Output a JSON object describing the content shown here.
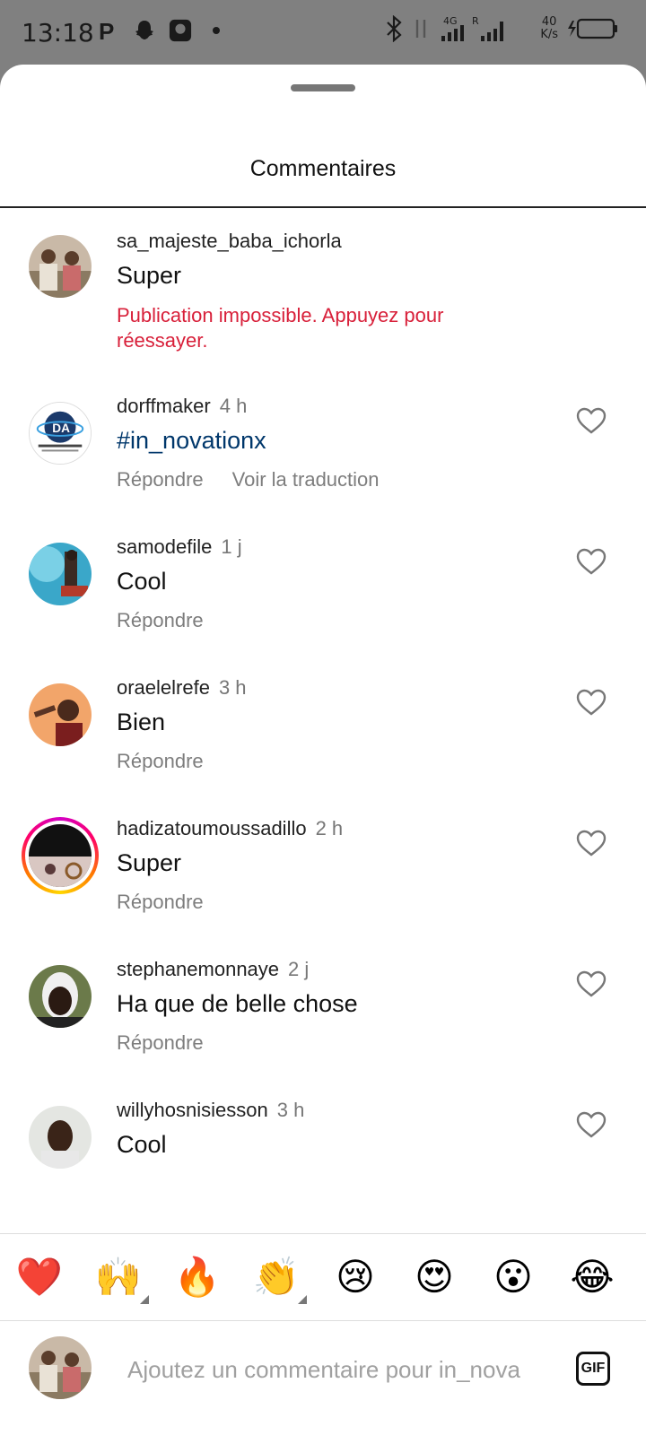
{
  "status_bar": {
    "time": "13:18",
    "net_speed": "40",
    "net_unit": "K/s"
  },
  "sheet": {
    "title": "Commentaires"
  },
  "comments": [
    {
      "username": "sa_majeste_baba_ichorla",
      "time": "",
      "text": "Super",
      "error": "Publication impossible. Appuyez pour réessayer."
    },
    {
      "username": "dorffmaker",
      "time": "4 h",
      "text": "#in_novationx",
      "reply": "Répondre",
      "translate": "Voir la traduction"
    },
    {
      "username": "samodefile",
      "time": "1 j",
      "text": "Cool",
      "reply": "Répondre"
    },
    {
      "username": "oraelelrefe",
      "time": "3 h",
      "text": "Bien",
      "reply": "Répondre"
    },
    {
      "username": "hadizatoumoussadillo",
      "time": "2 h",
      "text": "Super",
      "reply": "Répondre"
    },
    {
      "username": "stephanemonnaye",
      "time": "2 j",
      "text": "Ha que de belle chose",
      "reply": "Répondre"
    },
    {
      "username": "willyhosnisiesson",
      "time": "3 h",
      "text": "Cool"
    }
  ],
  "reactions": [
    "❤️",
    "🙌",
    "🔥",
    "👏",
    "😢",
    "😍",
    "😮",
    "😂"
  ],
  "composer": {
    "placeholder": "Ajoutez un commentaire pour in_nova",
    "gif_label": "GIF"
  },
  "colors": {
    "error": "#d8203a",
    "hashtag": "#00376b",
    "muted": "#7d7d7d"
  }
}
